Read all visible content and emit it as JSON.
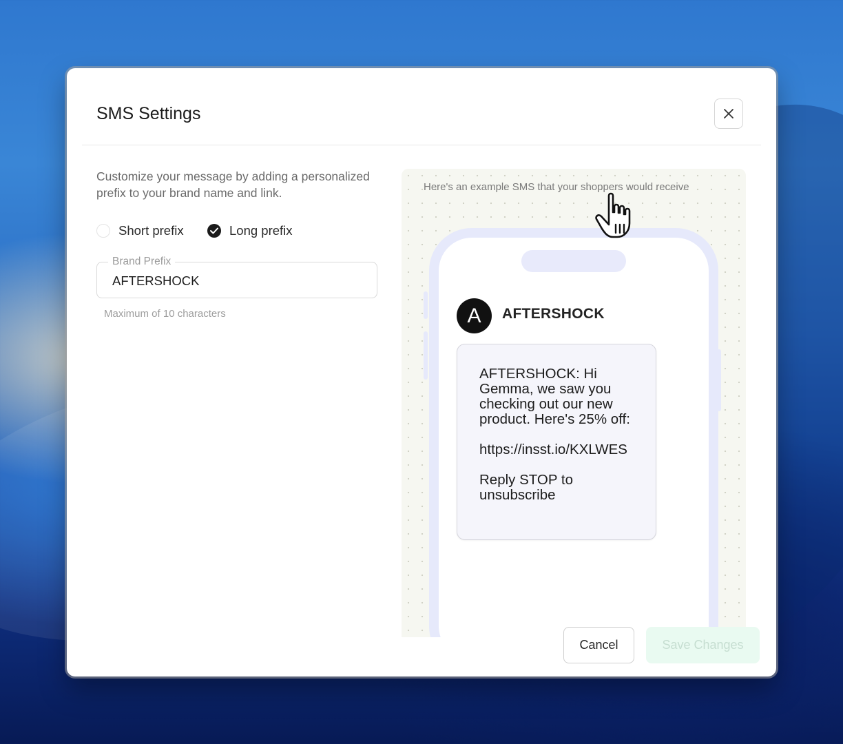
{
  "modal": {
    "title": "SMS Settings",
    "description": "Customize your message by adding a personalized prefix to your brand name and link.",
    "prefix_options": [
      {
        "label": "Short prefix",
        "selected": false
      },
      {
        "label": "Long prefix",
        "selected": true
      }
    ],
    "brand_prefix_field": {
      "label": "Brand Prefix",
      "value": "AFTERSHOCK",
      "helper": "Maximum of 10 characters"
    },
    "preview": {
      "caption": "Here's an example SMS that your shoppers would receive",
      "avatar_letter": "A",
      "sender": "AFTERSHOCK",
      "message_lines": [
        "AFTERSHOCK: Hi Gemma, we saw you checking out our new product. Here's 25% off:",
        "https://insst.io/KXLWES",
        "Reply STOP to unsubscribe"
      ]
    },
    "buttons": {
      "cancel": "Cancel",
      "save": "Save Changes"
    }
  },
  "icons": {
    "close": "close-icon",
    "check": "check-icon",
    "cursor": "hand-pointer-icon"
  },
  "colors": {
    "save_button_bg": "#e9faf1",
    "save_button_text": "#c6ded1",
    "phone_frame": "#e6e9fb",
    "preview_bg": "#f6f7f1"
  }
}
